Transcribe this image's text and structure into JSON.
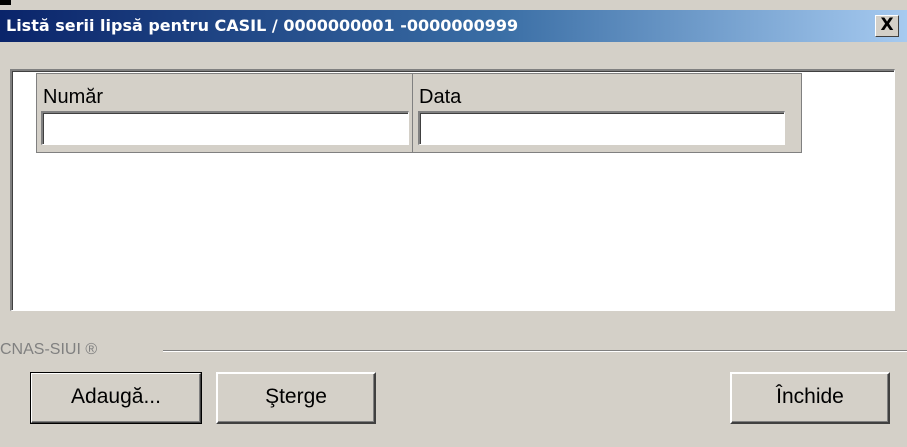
{
  "window": {
    "title": "Listă serii lipsă pentru CASIL / 0000000001 -0000000999",
    "close_glyph": "X"
  },
  "grid": {
    "columns": [
      {
        "header": "Număr",
        "value": ""
      },
      {
        "header": "Data",
        "value": ""
      }
    ]
  },
  "footer": {
    "brand": "CNAS-SIUI ®"
  },
  "buttons": {
    "add": "Adaugă...",
    "delete": "Şterge",
    "close": "Închide"
  },
  "colors": {
    "titlebar_start": "#0a246a",
    "titlebar_end": "#a6caf0",
    "face": "#d4d0c8"
  }
}
